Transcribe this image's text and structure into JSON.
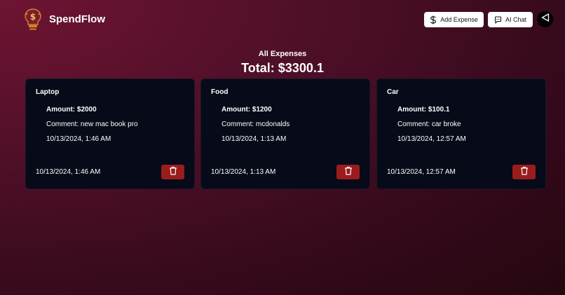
{
  "app": {
    "name": "SpendFlow"
  },
  "header": {
    "add_expense_label": "Add Expense",
    "ai_chat_label": "AI Chat"
  },
  "summary": {
    "heading": "All Expenses",
    "total": "Total: $3300.1"
  },
  "expenses": [
    {
      "title": "Laptop",
      "amount": "Amount: $2000",
      "comment": "Comment: new mac book pro",
      "date": "10/13/2024, 1:46 AM",
      "footer_date": "10/13/2024, 1:46 AM"
    },
    {
      "title": "Food",
      "amount": "Amount: $1200",
      "comment": "Comment: mcdonalds",
      "date": "10/13/2024, 1:13 AM",
      "footer_date": "10/13/2024, 1:13 AM"
    },
    {
      "title": "Car",
      "amount": "Amount: $100.1",
      "comment": "Comment: car broke",
      "date": "10/13/2024, 12:57 AM",
      "footer_date": "10/13/2024, 12:57 AM"
    }
  ],
  "colors": {
    "background_start": "#6e1433",
    "background_end": "#25070f",
    "card_bg": "#070a18",
    "delete_bg": "#9b1c1c",
    "button_bg": "#ffffff"
  },
  "icons": {
    "logo": "dollar-bulb-logo-icon",
    "add_expense": "dollar-icon",
    "ai_chat": "chat-bubble-icon",
    "collapse": "triangle-left-icon",
    "delete": "trash-icon"
  }
}
